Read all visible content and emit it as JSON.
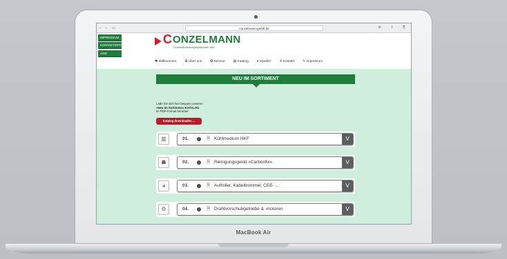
{
  "browser": {
    "url": "conzelmann-gmbh.de",
    "nav_glyphs": "‹ › ▭",
    "tool_glyphs": "⚙ ⇪ ⎘"
  },
  "side_nav": [
    "IMPRESSUM",
    "KONTAKTINFO",
    "AGB"
  ],
  "logo": {
    "c": "C",
    "word": "ONZELMANN",
    "sub": "Schweißhandelsgesellschaft mbH"
  },
  "menu": [
    "✱ Willkommen",
    "✿ Über uns",
    "✪ Service",
    "▤ Katalog",
    "♦ Händler",
    "✈ Kontakt",
    "✎ Impressum"
  ],
  "banner": "NEU IM SORTIMENT",
  "intro": {
    "line1": "Lade Sie sich hier bequem unseren",
    "line2": "»Neu im Sortiment«-KATALOG",
    "line3": "im PDF-Format herunter:"
  },
  "download_button": "Katalog downloaden ...",
  "items": [
    {
      "num": "01.",
      "name": "Kühlmedium HKF",
      "thumb": "▥"
    },
    {
      "num": "02.",
      "name": "Reinigungsgerät »Carbonfix«",
      "thumb": "☗"
    },
    {
      "num": "03.",
      "name": "Aufroller, Kabeltrommel, CEE- ...",
      "thumb": "◕"
    },
    {
      "num": "04.",
      "name": "Drahtvorschubgetriebe & -motoren",
      "thumb": "⚙"
    }
  ],
  "toggle_glyph": "V",
  "arrow_glyph": "›",
  "doc_glyph": "🗎",
  "brand_text": "MacBook Air",
  "colors": {
    "green": "#1f7d3c",
    "red": "#d0202b",
    "mint": "#cfeedd"
  }
}
